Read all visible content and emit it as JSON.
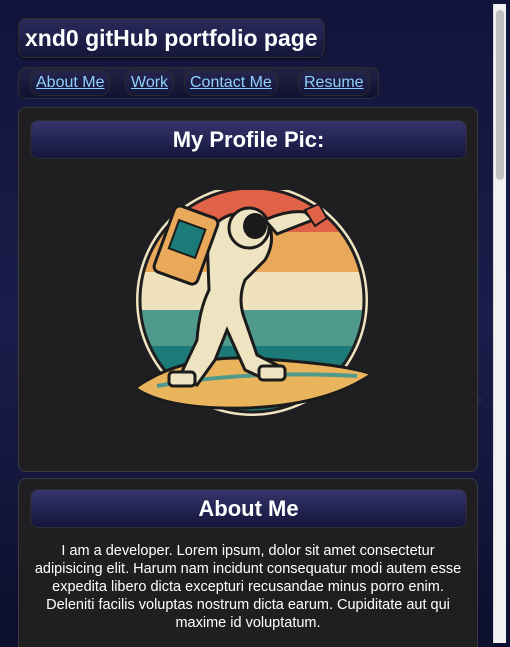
{
  "header": {
    "title": "xnd0 gitHub portfolio page"
  },
  "nav": {
    "items": [
      "About Me",
      "Work",
      "Contact Me",
      "Resume"
    ]
  },
  "profile": {
    "heading": "My Profile Pic:"
  },
  "about": {
    "heading": "About Me",
    "text": "I am a developer. Lorem ipsum, dolor sit amet consectetur adipisicing elit. Harum nam incidunt consequatur modi autem esse expedita libero dicta excepturi recusandae minus porro enim. Deleniti facilis voluptas nostrum dicta earum. Cupiditate aut qui maxime id voluptatum."
  },
  "colors": {
    "link": "#8fd0ff",
    "panel": "#1f1f22"
  },
  "icons": {
    "profile_image": "astronaut-surfer-illustration"
  }
}
